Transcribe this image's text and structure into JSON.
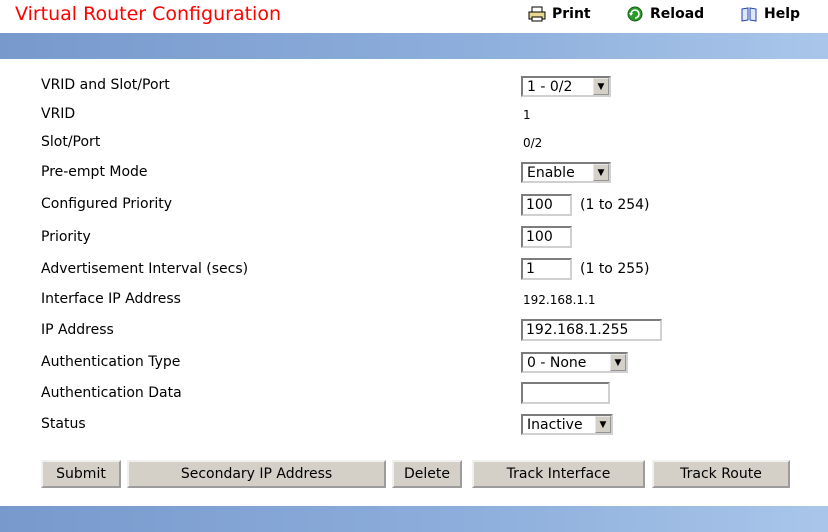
{
  "header": {
    "title": "Virtual Router Configuration",
    "print_label": "Print",
    "reload_label": "Reload",
    "help_label": "Help"
  },
  "form": {
    "vrid_slot_port": {
      "label": "VRID and Slot/Port",
      "value": "1 - 0/2"
    },
    "vrid": {
      "label": "VRID",
      "value": "1"
    },
    "slot_port": {
      "label": "Slot/Port",
      "value": "0/2"
    },
    "preempt_mode": {
      "label": "Pre-empt Mode",
      "value": "Enable"
    },
    "configured_priority": {
      "label": "Configured Priority",
      "value": "100",
      "hint": "(1 to 254)"
    },
    "priority": {
      "label": "Priority",
      "value": "100"
    },
    "adv_interval": {
      "label": "Advertisement Interval (secs)",
      "value": "1",
      "hint": "(1 to 255)"
    },
    "interface_ip": {
      "label": "Interface IP Address",
      "value": "192.168.1.1"
    },
    "ip_address": {
      "label": "IP Address",
      "value": "192.168.1.255"
    },
    "auth_type": {
      "label": "Authentication Type",
      "value": "0 - None"
    },
    "auth_data": {
      "label": "Authentication Data",
      "value": ""
    },
    "status": {
      "label": "Status",
      "value": "Inactive"
    }
  },
  "buttons": {
    "submit": "Submit",
    "secondary_ip": "Secondary IP Address",
    "delete": "Delete",
    "track_interface": "Track Interface",
    "track_route": "Track Route"
  },
  "colors": {
    "title": "#ff0000",
    "band": "#8fb0dd",
    "button_face": "#d4d0c8"
  }
}
